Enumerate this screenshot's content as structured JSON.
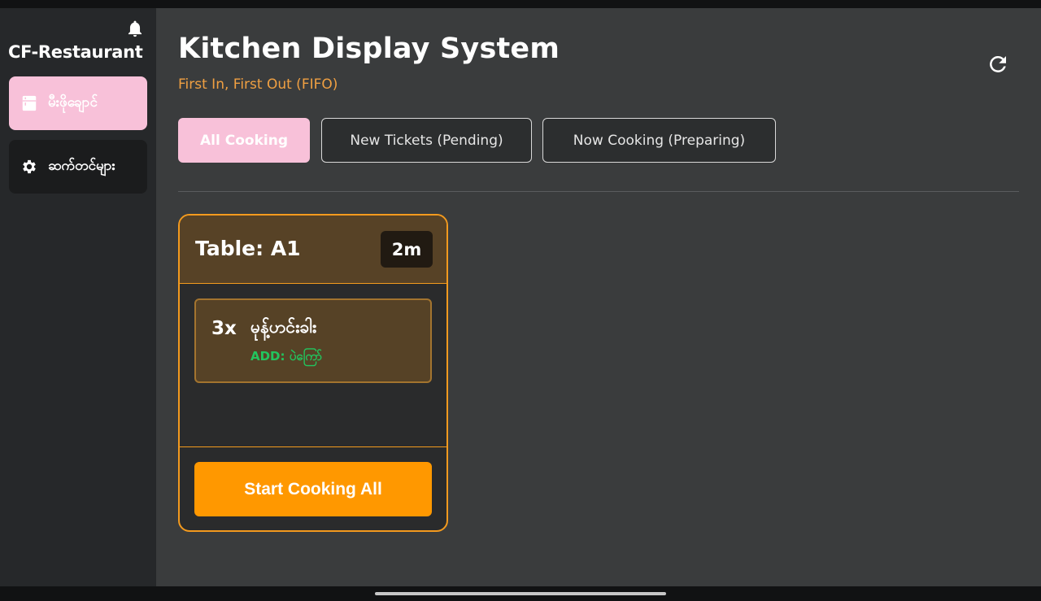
{
  "sidebar": {
    "brand": "CF-Restaurant",
    "notification_icon": "bell-icon",
    "items": [
      {
        "label": "မီးဖိုချောင်",
        "icon": "kitchen-icon",
        "active": true
      },
      {
        "label": "ဆက်တင်များ",
        "icon": "gear-icon",
        "active": false
      }
    ]
  },
  "header": {
    "title": "Kitchen Display System",
    "subtitle": "First In, First Out (FIFO)",
    "refresh_icon": "refresh-icon"
  },
  "tabs": [
    {
      "label": "All Cooking",
      "active": true
    },
    {
      "label": "New Tickets (Pending)",
      "active": false
    },
    {
      "label": "Now Cooking (Preparing)",
      "active": false
    }
  ],
  "tickets": [
    {
      "table": "Table: A1",
      "elapsed": "2m",
      "items": [
        {
          "qty": "3x",
          "name": "မုန့်ဟင်းခါး",
          "modifier": "ADD: ပဲကြော်"
        }
      ],
      "action_label": "Start Cooking All"
    }
  ],
  "colors": {
    "accent_pink": "#f8c1d9",
    "accent_orange": "#ff9800",
    "modifier_green": "#22c55e",
    "subtitle_orange": "#f0a042"
  }
}
